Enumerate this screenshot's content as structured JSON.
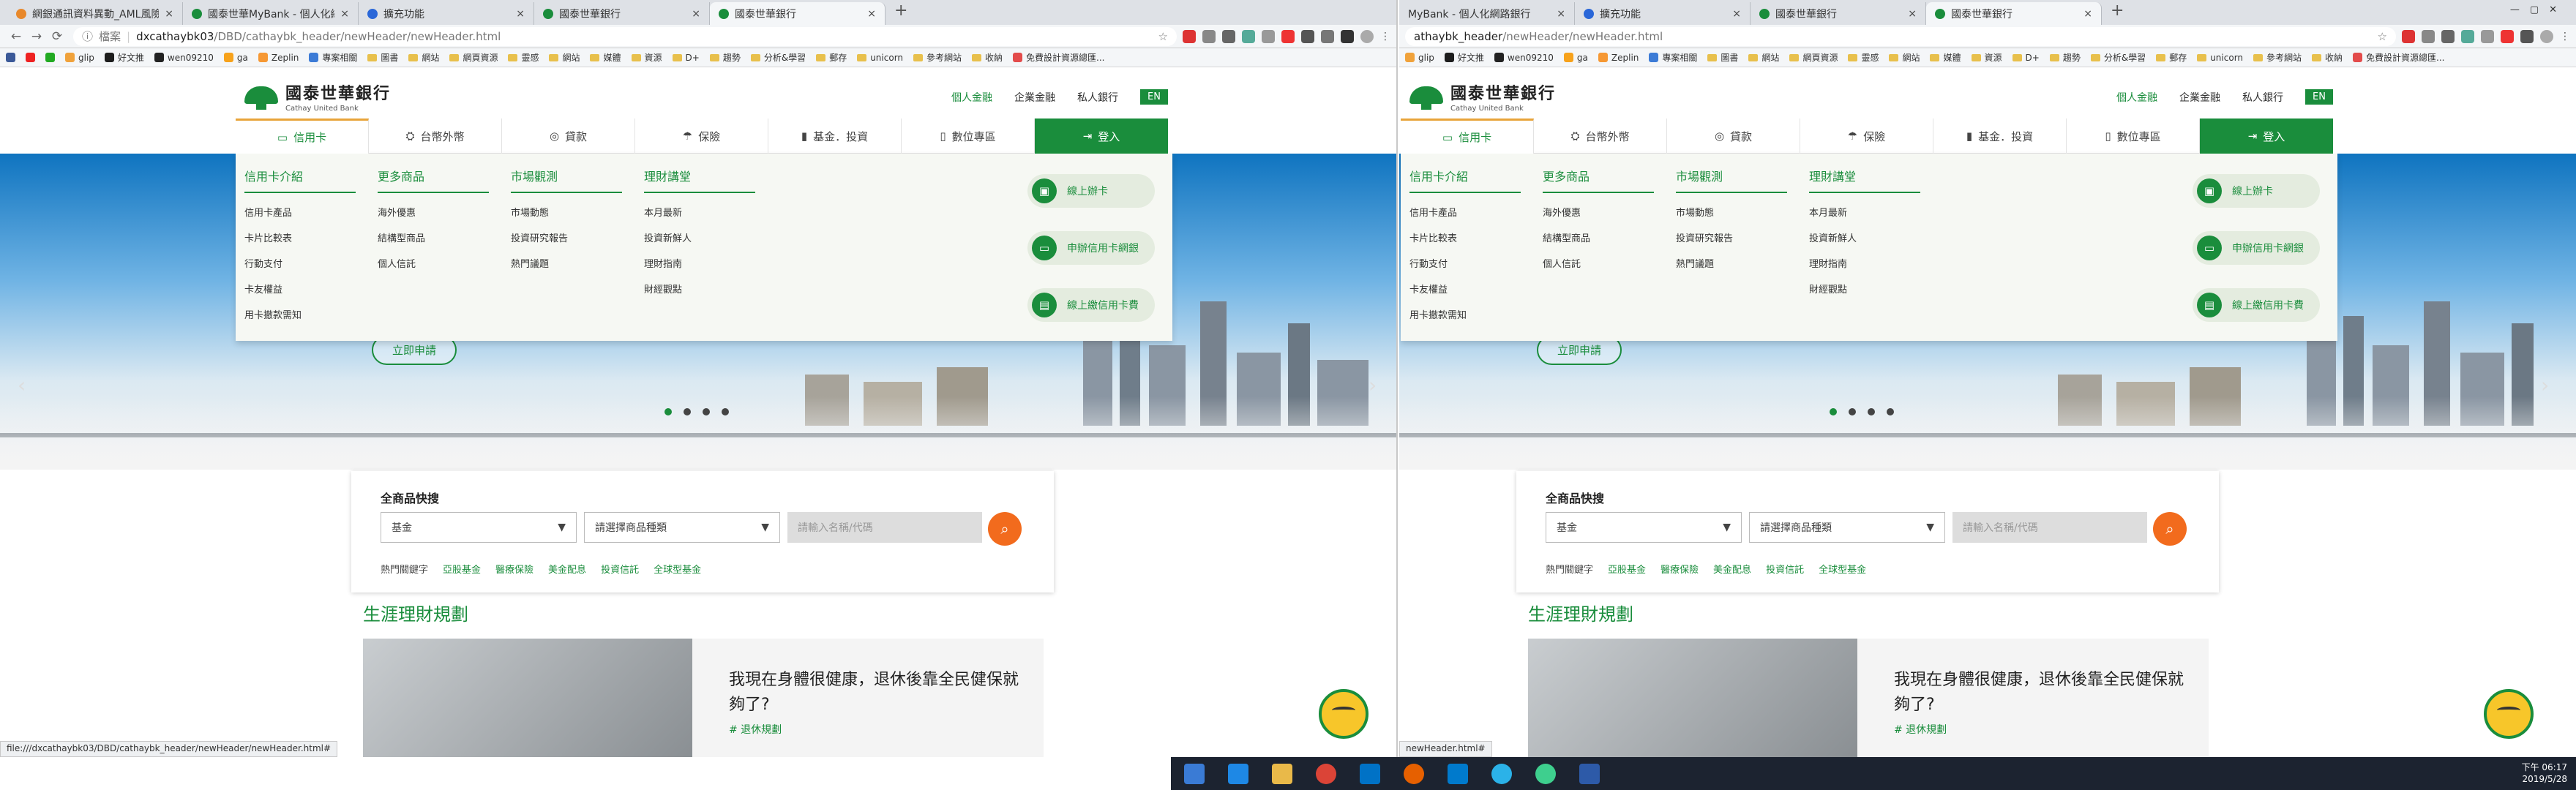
{
  "left": {
    "tabs": [
      {
        "label": "網銀通訊資料異動_AML風險資料...",
        "fav": "o"
      },
      {
        "label": "國泰世華MyBank - 個人化網路...",
        "fav": "g"
      },
      {
        "label": "擴充功能",
        "fav": "b"
      },
      {
        "label": "國泰世華銀行",
        "fav": "g"
      },
      {
        "label": "國泰世華銀行",
        "fav": "g",
        "active": true
      }
    ],
    "url_prefix": "檔案",
    "url_host": "dxcathaybk03",
    "url_path": "/DBD/cathaybk_header/newHeader/newHeader.html",
    "status": "file:///dxcathaybk03/DBD/cathaybk_header/newHeader/newHeader.html#"
  },
  "right": {
    "tabs": [
      {
        "label": "MyBank - 個人化網路銀行",
        "fav": "g"
      },
      {
        "label": "擴充功能",
        "fav": "b"
      },
      {
        "label": "國泰世華銀行",
        "fav": "g"
      },
      {
        "label": "國泰世華銀行",
        "fav": "g",
        "active": true
      }
    ],
    "url_prefix": "",
    "url_host": "athaybk_header",
    "url_path": "/newHeader/newHeader.html",
    "status": "newHeader.html#"
  },
  "bookmarks": [
    {
      "label": "glip",
      "type": "icon",
      "color": "#f0a23b"
    },
    {
      "label": "好文推",
      "type": "icon",
      "color": "#1d1d1d"
    },
    {
      "label": "wen09210",
      "type": "icon",
      "color": "#222"
    },
    {
      "label": "ga",
      "type": "icon",
      "color": "#f7a21b"
    },
    {
      "label": "Zeplin",
      "type": "icon",
      "color": "#f69833"
    },
    {
      "label": "專案相關",
      "type": "icon",
      "color": "#3c7bd6"
    },
    {
      "label": "圖書",
      "type": "folder"
    },
    {
      "label": "網站",
      "type": "folder"
    },
    {
      "label": "網頁資源",
      "type": "folder"
    },
    {
      "label": "靈感",
      "type": "folder"
    },
    {
      "label": "網站",
      "type": "folder"
    },
    {
      "label": "媒體",
      "type": "folder"
    },
    {
      "label": "資源",
      "type": "folder"
    },
    {
      "label": "D+",
      "type": "folder"
    },
    {
      "label": "趨勢",
      "type": "folder"
    },
    {
      "label": "分析&學習",
      "type": "folder"
    },
    {
      "label": "郵存",
      "type": "folder"
    },
    {
      "label": "unicorn",
      "type": "folder"
    },
    {
      "label": "參考網站",
      "type": "folder"
    },
    {
      "label": "收納",
      "type": "folder"
    },
    {
      "label": "免費設計資源總匯...",
      "type": "icon",
      "color": "#e34b4b"
    }
  ],
  "site": {
    "logo_zh": "國泰世華銀行",
    "logo_en": "Cathay United Bank",
    "toplinks": [
      "個人金融",
      "企業金融",
      "私人銀行"
    ],
    "en_label": "EN",
    "nav": [
      {
        "icon": "▭",
        "label": "信用卡"
      },
      {
        "icon": "⛭",
        "label": "台幣外幣"
      },
      {
        "icon": "◎",
        "label": "貸款"
      },
      {
        "icon": "☂",
        "label": "保險"
      },
      {
        "icon": "▮",
        "label": "基金．投資"
      },
      {
        "icon": "▯",
        "label": "數位專區"
      },
      {
        "icon": "⇥",
        "label": "登入"
      }
    ],
    "mega": [
      {
        "title": "信用卡介紹",
        "items": [
          "信用卡產品",
          "卡片比較表",
          "行動支付",
          "卡友權益",
          "用卡撤款需知"
        ]
      },
      {
        "title": "更多商品",
        "items": [
          "海外優惠",
          "結構型商品",
          "個人信託"
        ]
      },
      {
        "title": "市場觀測",
        "items": [
          "市場動態",
          "投資研究報告",
          "熱門議題"
        ]
      },
      {
        "title": "理財講堂",
        "items": [
          "本月最新",
          "投資新鮮人",
          "理財指南",
          "財經觀點"
        ]
      }
    ],
    "quick": [
      "線上辦卡",
      "申辦信用卡網銀",
      "線上繳信用卡費"
    ],
    "apply": "立即申請",
    "search_title": "全商品快搜",
    "select1": "基金",
    "select2": "請選擇商品種類",
    "kw_placeholder": "請輸入名稱/代碼",
    "hot_label": "熱門關鍵字",
    "hot": [
      "亞股基金",
      "醫療保險",
      "美金配息",
      "投資信託",
      "全球型基金"
    ],
    "life_title": "生涯理財規劃",
    "life_heading": "我現在身體很健康，退休後靠全民健保就夠了?",
    "life_tag": "# 退休規劃"
  },
  "tray": {
    "time": "下午 06:17",
    "date": "2019/5/28"
  }
}
